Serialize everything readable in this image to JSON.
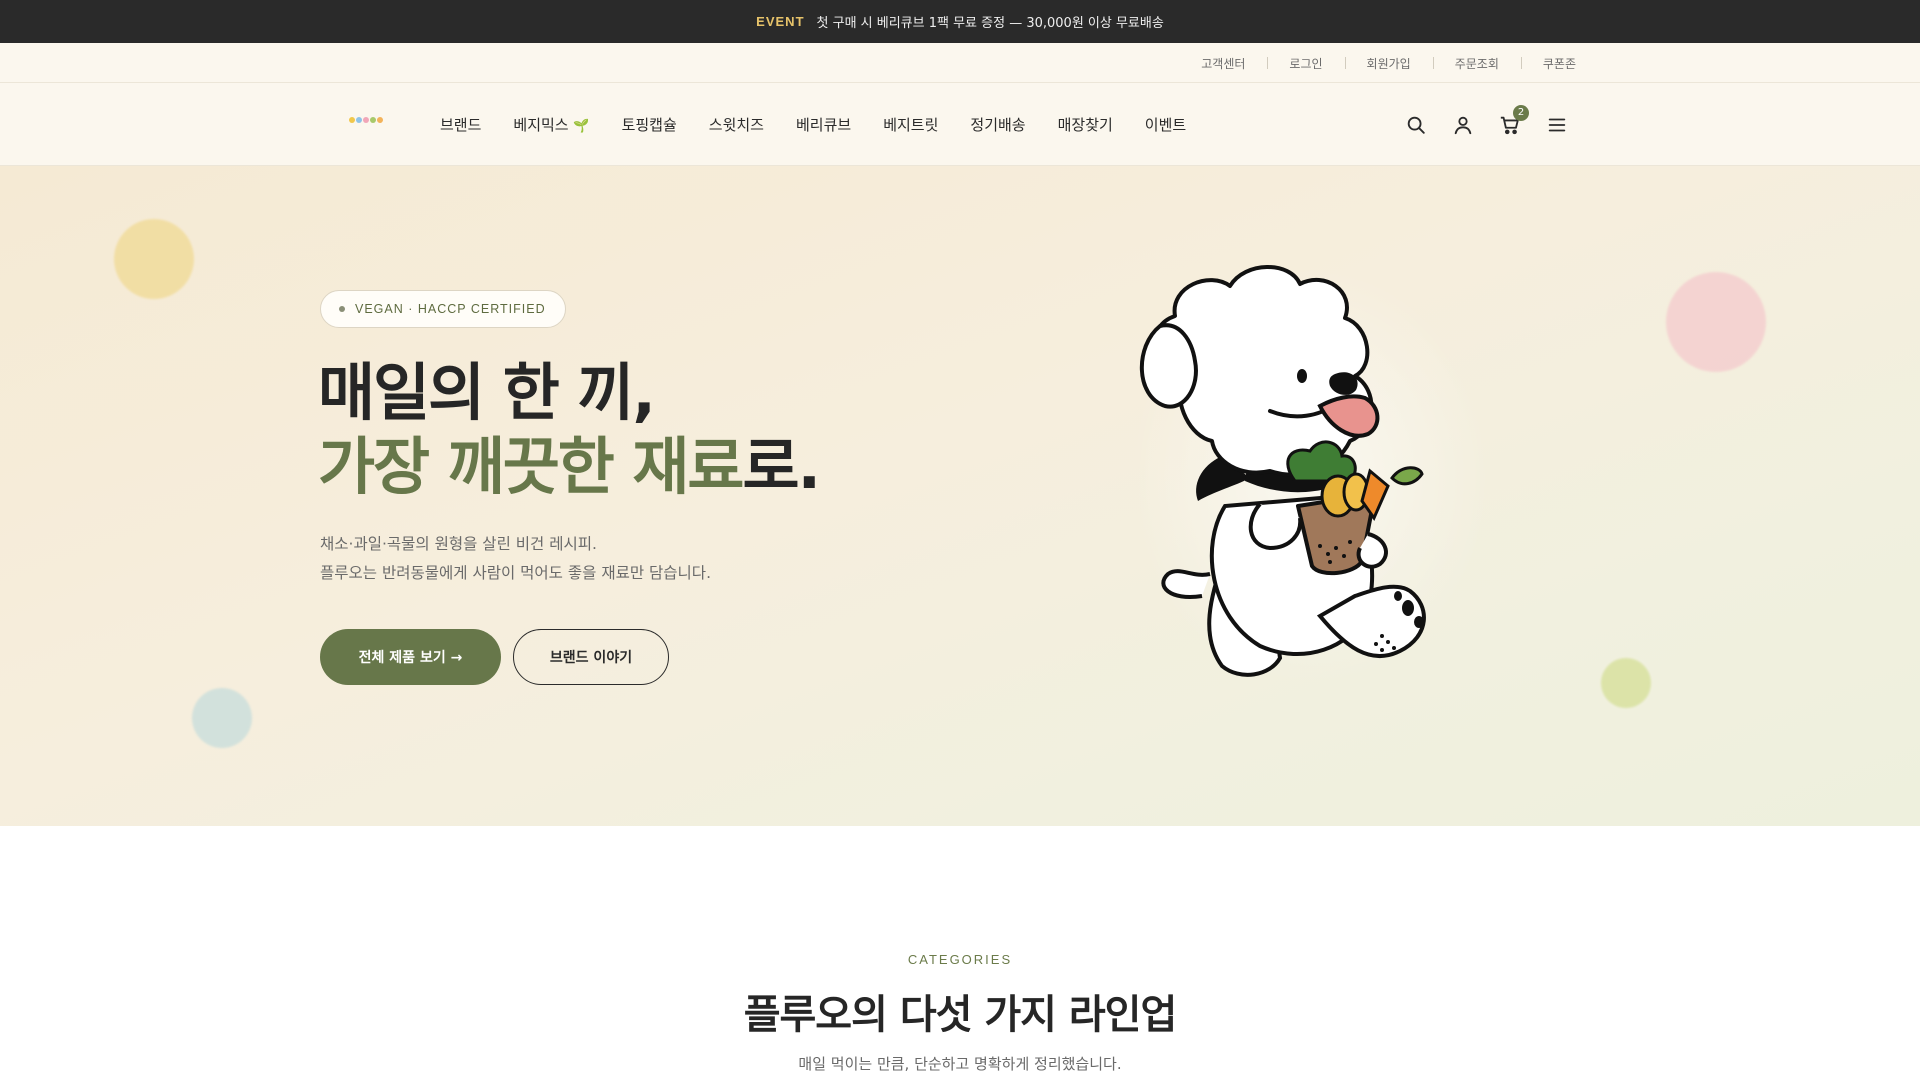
{
  "event_bar": {
    "tag": "EVENT",
    "message": "첫 구매 시 베리큐브 1팩 무료 증정 — 30,000원 이상 무료배송"
  },
  "utility_links": [
    "고객센터",
    "로그인",
    "회원가입",
    "주문조회",
    "쿠폰존"
  ],
  "nav": {
    "items": [
      "브랜드",
      "베지믹스",
      "토핑캡슐",
      "스윗치즈",
      "베리큐브",
      "베지트릿",
      "정기배송",
      "매장찾기",
      "이벤트"
    ],
    "leaf_glyph": "🌱"
  },
  "header_icons": {
    "search": "search-icon",
    "account": "user-icon",
    "cart": "cart-icon",
    "menu": "hamburger-menu-icon",
    "cart_count": "2"
  },
  "hero": {
    "badge": "VEGAN · HACCP CERTIFIED",
    "title_line1": "매일의 한 끼,",
    "title_line2_green": "가장 깨끗한 재료",
    "title_line2_suffix": "로.",
    "desc_line1": "채소·과일·곡물의 원형을 살린 비건 레시피.",
    "desc_line2": "플루오는 반려동물에게 사람이 먹어도 좋을 재료만 담습니다.",
    "primary_button": "전체 제품 보기 →",
    "secondary_button": "브랜드 이야기"
  },
  "categories": {
    "label": "CATEGORIES",
    "title": "플루오의 다섯 가지 라인업",
    "subtitle": "매일 먹이는 만큼, 단순하고 명확하게 정리했습니다."
  },
  "colors": {
    "brand_green": "#67774a",
    "event_accent": "#e7c36a",
    "dark": "#2a2a2a",
    "cream": "#fbf7ee"
  }
}
